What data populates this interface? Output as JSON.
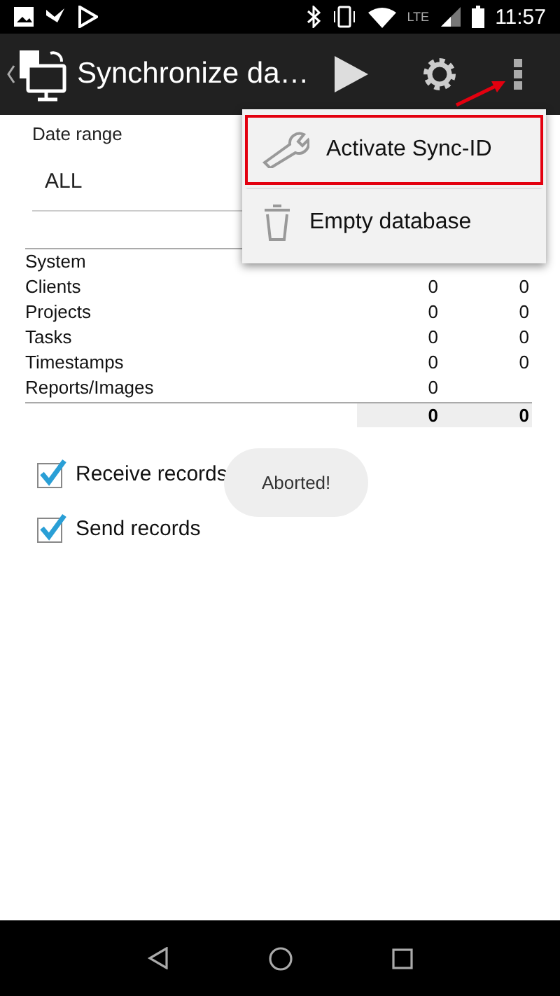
{
  "status_bar": {
    "network": "LTE",
    "time": "11:57"
  },
  "toolbar": {
    "title": "Synchronize da…"
  },
  "date_range": {
    "label": "Date range",
    "value": "ALL"
  },
  "table": {
    "rows": [
      {
        "label": "System",
        "values": []
      },
      {
        "label": "Clients",
        "values": [
          "0",
          "0"
        ]
      },
      {
        "label": "Projects",
        "values": [
          "0",
          "0"
        ]
      },
      {
        "label": "Tasks",
        "values": [
          "0",
          "0"
        ]
      },
      {
        "label": "Timestamps",
        "values": [
          "0",
          "0"
        ]
      },
      {
        "label": "Reports/Images",
        "values": [
          "0"
        ]
      }
    ],
    "totals": [
      "0",
      "0"
    ]
  },
  "options": [
    {
      "label": "Receive records",
      "checked": true
    },
    {
      "label": "Send records",
      "checked": true
    }
  ],
  "toast": {
    "text": "Aborted!"
  },
  "menu": {
    "items": [
      {
        "kind": "wrench",
        "label": "Activate Sync-ID",
        "highlighted": true
      },
      {
        "kind": "trash",
        "label": "Empty database",
        "highlighted": false
      }
    ]
  }
}
